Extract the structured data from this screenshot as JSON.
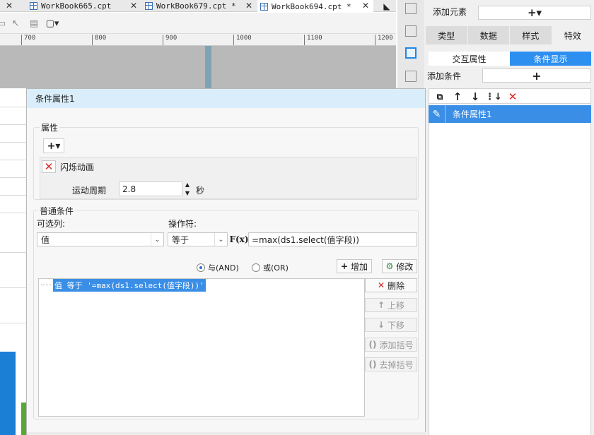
{
  "tabs": [
    {
      "label": "WorkBook665.cpt"
    },
    {
      "label": "WorkBook679.cpt *"
    },
    {
      "label": "WorkBook694.cpt *"
    }
  ],
  "ruler": {
    "ticks": [
      "700",
      "800",
      "900",
      "1000",
      "1100",
      "1200"
    ]
  },
  "right_panel": {
    "add_element_label": "添加元素",
    "add_element_button": "+▾",
    "tabs": [
      "类型",
      "数据",
      "样式",
      "特效"
    ],
    "subtabs": [
      "交互属性",
      "条件显示"
    ],
    "add_condition_label": "添加条件",
    "add_condition_button": "+",
    "list_item": "条件属性1"
  },
  "dialog": {
    "title": "条件属性1",
    "properties_group": "属性",
    "add_property_button": "+▾",
    "flash_label": "闪烁动画",
    "period_label": "运动周期",
    "period_value": "2.8",
    "seconds_label": "秒",
    "common_group": "普通条件",
    "column_label": "可选列:",
    "column_value": "值",
    "operator_label": "操作符:",
    "operator_value": "等于",
    "fx_label": "F(x)",
    "formula_value": "=max(ds1.select(值字段))",
    "radio_and": "与(AND)",
    "radio_or": "或(OR)",
    "add_button": "增加",
    "modify_button": "修改",
    "delete_button": "删除",
    "up_button": "上移",
    "down_button": "下移",
    "add_bracket_button": "添加括号",
    "remove_bracket_button": "去掉括号",
    "condition_item": "值 等于 '=max(ds1.select(值字段))'"
  },
  "colors": {
    "accent_blue": "#3a8ee6",
    "dialog_title_bg": "#d9eefa",
    "delete_red": "#e02020"
  }
}
